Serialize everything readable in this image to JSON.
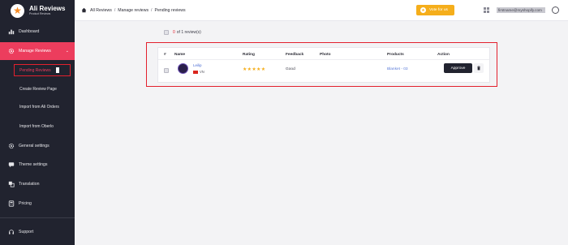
{
  "app": {
    "title": "Ali Reviews",
    "subtitle": "Product Reviews",
    "logo_icon": "star-icon"
  },
  "sidebar": {
    "items": [
      {
        "label": "Dashboard",
        "icon": "bar-chart-icon"
      },
      {
        "label": "Manage Reviews",
        "icon": "gear-icon",
        "active": true
      },
      {
        "label": "General settings",
        "icon": "gear-icon"
      },
      {
        "label": "Theme settings",
        "icon": "chat-icon"
      },
      {
        "label": "Translation",
        "icon": "translate-icon"
      },
      {
        "label": "Pricing",
        "icon": "calculator-icon"
      },
      {
        "label": "Support",
        "icon": "headset-icon"
      }
    ],
    "sub_items": [
      {
        "label": "Pending Reviews",
        "selected": true
      },
      {
        "label": "Create Review Page"
      },
      {
        "label": "Import from Ali Orders"
      },
      {
        "label": "Import from Oberlo"
      }
    ]
  },
  "topbar": {
    "breadcrumbs": [
      "All Reviews",
      "Manage reviews",
      "Pending reviews"
    ],
    "vote_label": "Vote for us",
    "store": "firstname@myshopify.com"
  },
  "content": {
    "count_selected": "0",
    "count_text": "of 1 review(s)",
    "columns": [
      "#",
      "Name",
      "Rating",
      "Feedback",
      "Photo",
      "Products",
      "Action"
    ],
    "row": {
      "name": "Leilip",
      "country": "VN",
      "rating": 5,
      "stars": "★★★★★",
      "feedback": "Good",
      "photo": "",
      "product": "Blanket - 03",
      "approve_label": "Approve"
    }
  },
  "colors": {
    "sidebar_bg": "#21232f",
    "accent": "#ec3d5d",
    "vote_button": "#f5ae1b",
    "highlight_border": "#e3202d"
  }
}
